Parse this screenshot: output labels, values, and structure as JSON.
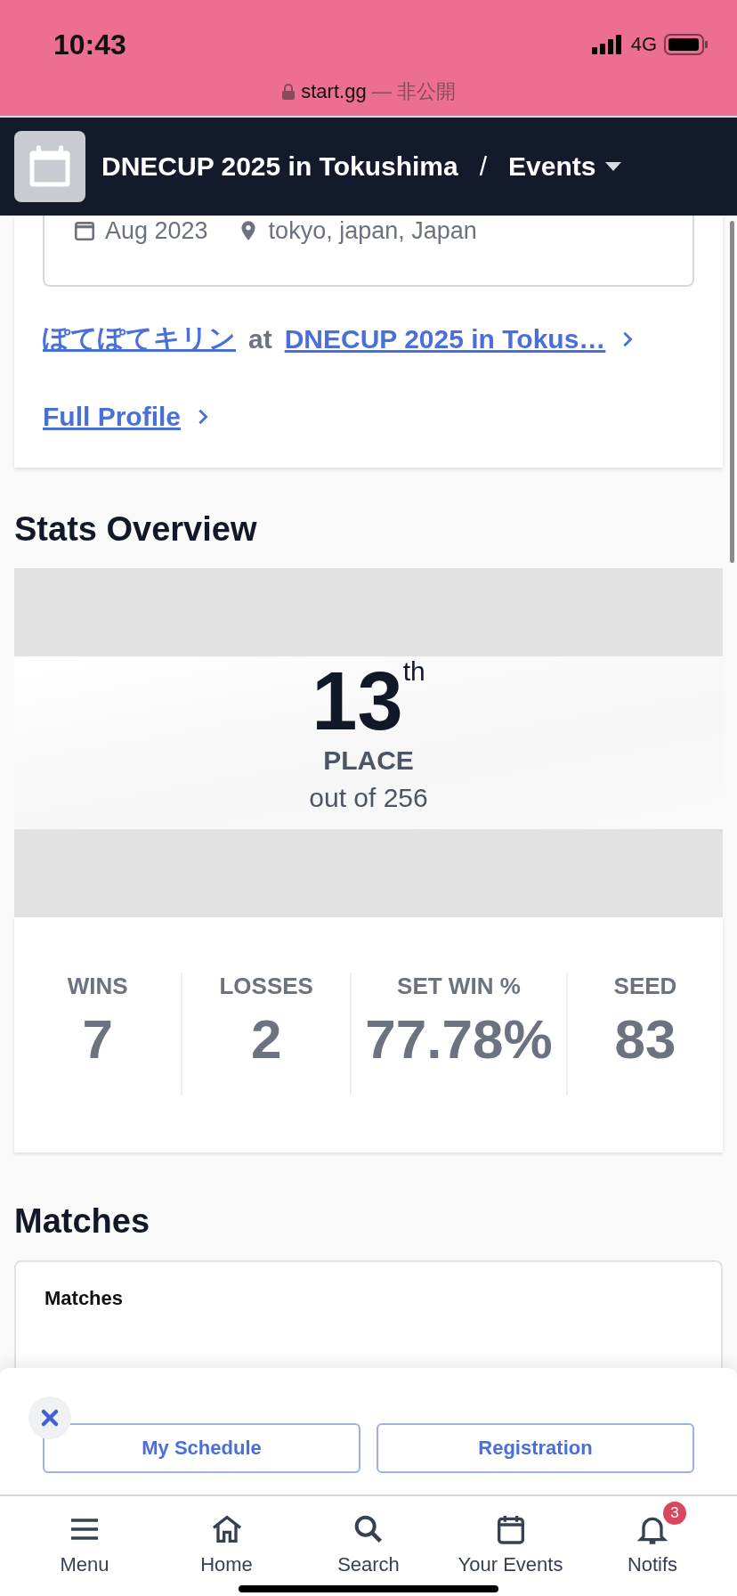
{
  "status_bar": {
    "time": "10:43",
    "network": "4G"
  },
  "address_bar": {
    "domain": "start.gg",
    "note": "— 非公開"
  },
  "header": {
    "title": "DNECUP 2025 in Tokushima",
    "separator": "/",
    "section": "Events"
  },
  "entrant_card": {
    "date": "Aug 2023",
    "location": "tokyo, japan, Japan",
    "entrant_link": {
      "player": "ぽてぽてキリン",
      "joiner": "at",
      "event": "DNECUP 2025 in Tokus…"
    },
    "profile_link": "Full Profile"
  },
  "stats": {
    "heading": "Stats Overview",
    "placement": "13",
    "suffix": "th",
    "place_label": "PLACE",
    "out_of": "out of 256",
    "items": [
      {
        "label": "WINS",
        "value": "7"
      },
      {
        "label": "LOSSES",
        "value": "2"
      },
      {
        "label": "SET WIN %",
        "value": "77.78%"
      },
      {
        "label": "SEED",
        "value": "83"
      }
    ]
  },
  "matches": {
    "heading": "Matches",
    "card_title": "Matches"
  },
  "action_sheet": {
    "buttons": [
      "My Schedule",
      "Registration"
    ]
  },
  "tab_bar": [
    {
      "kind": "menu",
      "label": "Menu"
    },
    {
      "kind": "home",
      "label": "Home"
    },
    {
      "kind": "search",
      "label": "Search"
    },
    {
      "kind": "calendar",
      "label": "Your Events"
    },
    {
      "kind": "bell",
      "label": "Notifs",
      "badge": "3"
    }
  ]
}
